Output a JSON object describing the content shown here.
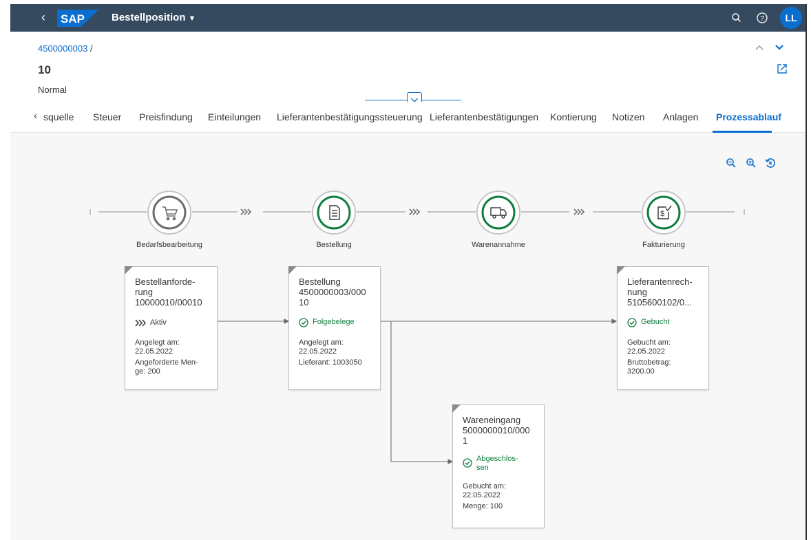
{
  "shell": {
    "title": "Bestellposition",
    "logo": "SAP",
    "avatar_initials": "LL"
  },
  "header": {
    "breadcrumb_link": "4500000003",
    "breadcrumb_sep": "/",
    "title": "10",
    "subtitle": "Normal"
  },
  "tabs": [
    {
      "label": "squelle"
    },
    {
      "label": "Steuer"
    },
    {
      "label": "Preisfindung"
    },
    {
      "label": "Einteilungen"
    },
    {
      "label": "Lieferantenbestätigungssteuerung"
    },
    {
      "label": "Lieferantenbestätigungen"
    },
    {
      "label": "Kontierung"
    },
    {
      "label": "Notizen"
    },
    {
      "label": "Anlagen"
    },
    {
      "label": "Prozessablauf",
      "active": true
    }
  ],
  "lanes": [
    {
      "label": "Bedarfsbearbeitung",
      "icon": "cart-icon",
      "state": "neutral"
    },
    {
      "label": "Bestellung",
      "icon": "document-list-icon",
      "state": "positive"
    },
    {
      "label": "Warenannahme",
      "icon": "truck-icon",
      "state": "positive"
    },
    {
      "label": "Fakturierung",
      "icon": "invoice-icon",
      "state": "positive"
    }
  ],
  "nodes": [
    {
      "title_lines": [
        "Bestellanforde-",
        "rung",
        "10000010/00010"
      ],
      "status": "Aktiv",
      "status_icon": "process-chevrons-icon",
      "meta_lines": [
        "Angelegt am:",
        "22.05.2022",
        "Angeforderte Men-",
        "ge: 200"
      ]
    },
    {
      "title_lines": [
        "Bestellung",
        "4500000003/000",
        "10"
      ],
      "status": "Folgebelege",
      "status_icon": "check-circle-icon",
      "meta_lines": [
        "Angelegt am:",
        "22.05.2022",
        "Lieferant: 1003050"
      ]
    },
    {
      "title_lines": [
        "Wareneingang",
        "5000000010/000",
        "1"
      ],
      "status_lines": [
        "Abgeschlos-",
        "sen"
      ],
      "status_icon": "check-circle-icon",
      "meta_lines": [
        "Gebucht am:",
        "22.05.2022",
        "Menge: 100"
      ]
    },
    {
      "title_lines": [
        "Lieferantenrech-",
        "nung",
        "5105600102/0..."
      ],
      "status": "Gebucht",
      "status_icon": "check-circle-icon",
      "meta_lines": [
        "Gebucht am:",
        "22.05.2022",
        "Bruttobetrag:",
        "3200.00"
      ]
    }
  ],
  "colors": {
    "shell": "#354a5f",
    "accent": "#0a6ed1",
    "positive": "#107e3e",
    "neutral": "#6a6d70"
  }
}
